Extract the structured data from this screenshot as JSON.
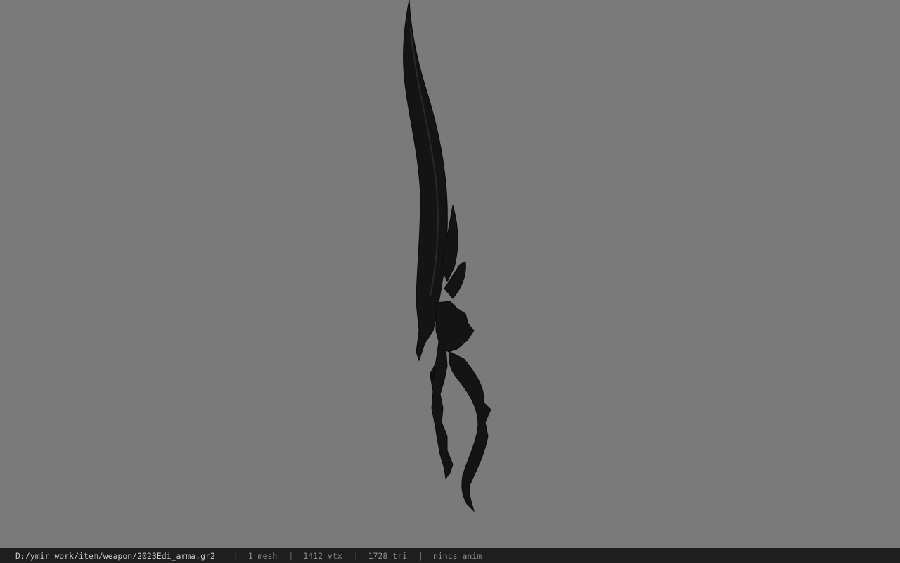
{
  "viewer": {
    "background_color": "#7a7a7a",
    "model_color": "#141414",
    "model_icon": "dark-curved-sword-model"
  },
  "status": {
    "file_path": "D:/ymir work/item/weapon/2023Edi_arma.gr2",
    "separator": "|",
    "mesh_count": "1 mesh",
    "vertex_count": "1412 vtx",
    "triangle_count": "1728 tri",
    "animation_status": "nincs anim"
  }
}
